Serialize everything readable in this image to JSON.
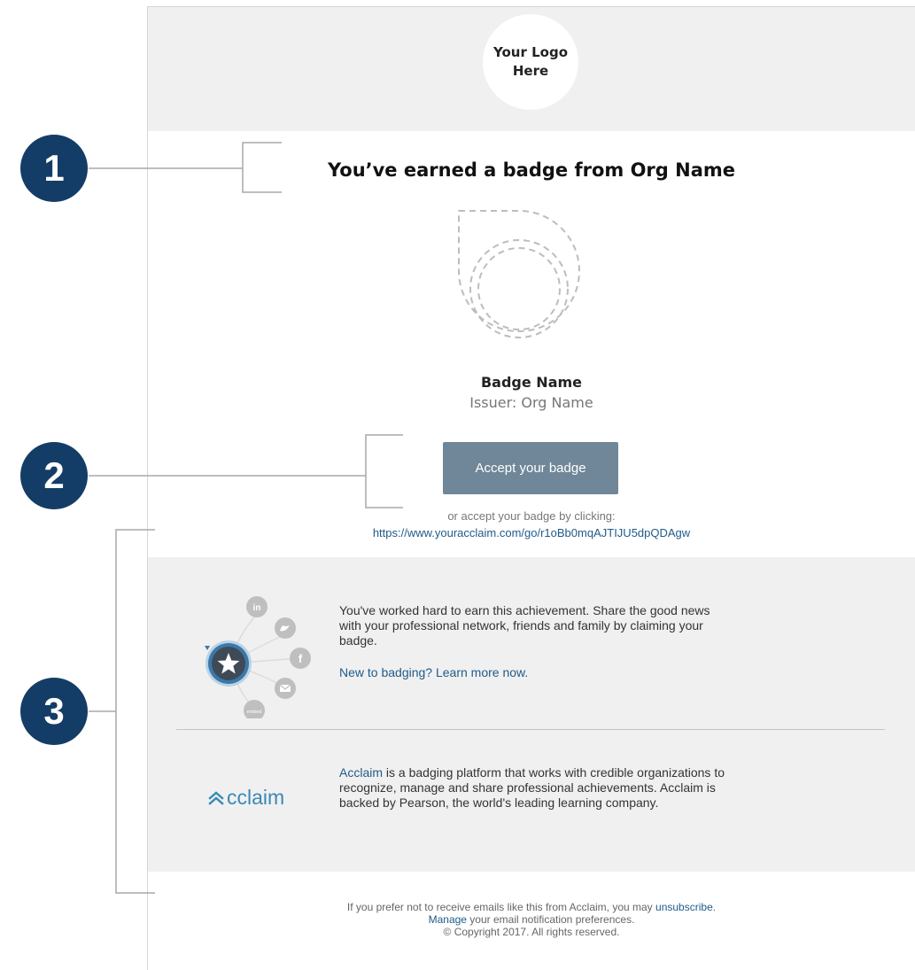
{
  "header": {
    "logo_line1": "Your Logo",
    "logo_line2": "Here"
  },
  "headline": "You’ve earned a badge from Org Name",
  "badge": {
    "name": "Badge Name",
    "issuer": "Issuer: Org Name"
  },
  "accept_button": "Accept your badge",
  "alternate": {
    "text": "or accept your badge by clicking:",
    "url": "https://www.youracclaim.com/go/r1oBb0mqAJTIJU5dpQDAgw"
  },
  "share": {
    "text": "You've worked hard to earn this achievement. Share the good news with your professional network, friends and family by claiming your badge.",
    "learn_link": "New to badging? Learn more now.",
    "icons": [
      "linkedin-icon",
      "twitter-icon",
      "facebook-icon",
      "email-icon",
      "embed-icon",
      "star-badge-icon"
    ]
  },
  "about": {
    "logo_text": "cclaim",
    "link": "Acclaim",
    "text": " is a badging platform that works with credible organizations to recognize, manage and share professional achievements. Acclaim is backed by Pearson, the world's leading learning company."
  },
  "footer": {
    "pre": "If you prefer not to receive emails like this from Acclaim, you may ",
    "unsubscribe": "unsubscribe",
    "post": ".",
    "manage": "Manage",
    "manage_rest": " your email notification preferences.",
    "copyright": "© Copyright 2017. All rights reserved."
  },
  "callouts": [
    "1",
    "2",
    "3"
  ],
  "colors": {
    "navy": "#133d66",
    "button": "#6f8798",
    "link": "#1f5b8a",
    "acclaim_blue": "#3b88b6",
    "panel": "#f0f0f0"
  }
}
